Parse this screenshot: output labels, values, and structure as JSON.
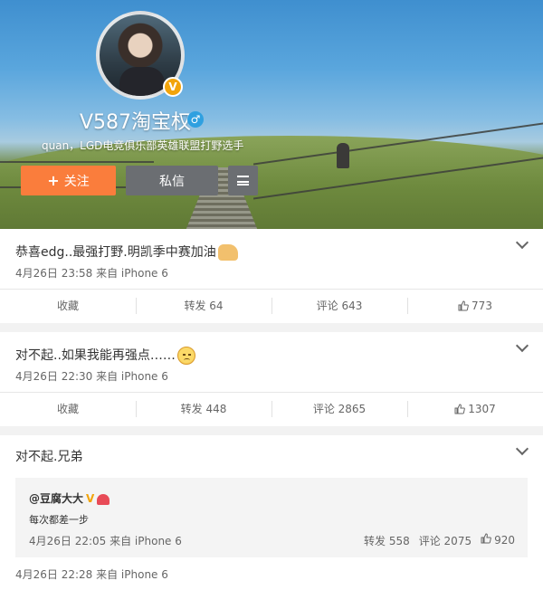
{
  "profile": {
    "name": "V587淘宝权",
    "verified_badge": "V",
    "gender_icon": "♂",
    "bio": "quan，LGD电竞俱乐部英雄联盟打野选手",
    "follow_label": "关注",
    "follow_plus": "+",
    "message_label": "私信",
    "accent_color": "#fa7d3c"
  },
  "posts": [
    {
      "text": "恭喜edg..最强打野.明凯季中赛加油",
      "emoji": "thumbs-up",
      "meta": "4月26日 23:58 来自 iPhone 6",
      "actions": {
        "favorite": "收藏",
        "repost": "转发 64",
        "comment": "评论 643",
        "like": "773"
      }
    },
    {
      "text": "对不起..如果我能再强点……",
      "emoji": "sad-face",
      "meta": "4月26日 22:30 来自 iPhone 6",
      "actions": {
        "favorite": "收藏",
        "repost": "转发 448",
        "comment": "评论 2865",
        "like": "1307"
      }
    },
    {
      "text": "对不起.兄弟",
      "repost": {
        "user": "@豆腐大大",
        "v": "V",
        "text": "每次都差一步",
        "meta": "4月26日 22:05 来自 iPhone 6",
        "repost_count": "转发 558",
        "comment_count": "评论 2075",
        "like_count": "920"
      },
      "meta": "4月26日 22:28 来自 iPhone 6"
    }
  ]
}
